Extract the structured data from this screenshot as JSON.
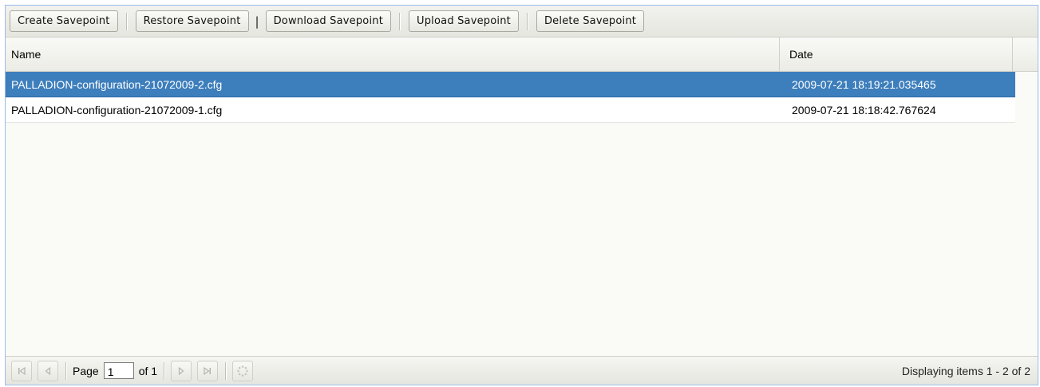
{
  "toolbar": {
    "buttons": [
      {
        "label": "Create Savepoint"
      },
      {
        "label": "Restore Savepoint"
      },
      {
        "label": "Download Savepoint"
      },
      {
        "label": "Upload Savepoint"
      },
      {
        "label": "Delete Savepoint"
      }
    ],
    "pipe_text": "|"
  },
  "grid": {
    "columns": [
      "Name",
      "Date"
    ],
    "rows": [
      {
        "name": "PALLADION-configuration-21072009-2.cfg",
        "date": "2009-07-21 18:19:21.035465",
        "selected": true
      },
      {
        "name": "PALLADION-configuration-21072009-1.cfg",
        "date": "2009-07-21 18:18:42.767624",
        "selected": false
      }
    ]
  },
  "paging": {
    "page_label": "Page",
    "page_value": "1",
    "of_label": "of 1",
    "display_info": "Displaying items 1 - 2 of 2"
  },
  "icons": {
    "first": "first-page-icon",
    "prev": "prev-page-icon",
    "next": "next-page-icon",
    "last": "last-page-icon",
    "refresh": "refresh-icon"
  },
  "colors": {
    "selected_row": "#3d7ebc",
    "panel_border": "#99bbe8"
  }
}
